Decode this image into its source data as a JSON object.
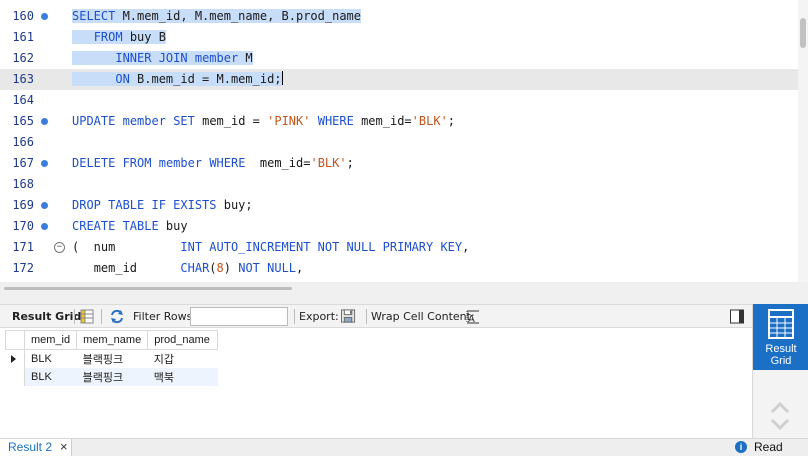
{
  "editor": {
    "lines": [
      {
        "n": "160",
        "marker": true,
        "fold": false,
        "current": false,
        "selected": true,
        "indent": "",
        "tokens": [
          [
            "kw",
            "SELECT"
          ],
          [
            "t",
            " M.mem_id, M.mem_name, B.prod_name"
          ]
        ]
      },
      {
        "n": "161",
        "marker": false,
        "fold": false,
        "current": false,
        "selected": true,
        "indent": "   ",
        "tokens": [
          [
            "kw",
            "FROM"
          ],
          [
            "t",
            " buy B"
          ]
        ]
      },
      {
        "n": "162",
        "marker": false,
        "fold": false,
        "current": false,
        "selected": true,
        "indent": "      ",
        "tokens": [
          [
            "kw",
            "INNER JOIN"
          ],
          [
            "t",
            " "
          ],
          [
            "kw",
            "member"
          ],
          [
            "t",
            " M"
          ]
        ]
      },
      {
        "n": "163",
        "marker": false,
        "fold": false,
        "current": true,
        "selected": true,
        "indent": "      ",
        "tokens": [
          [
            "kw",
            "ON"
          ],
          [
            "t",
            " B.mem_id = M.mem_id;"
          ]
        ]
      },
      {
        "n": "164",
        "marker": false,
        "fold": false,
        "current": false,
        "selected": false,
        "indent": "",
        "tokens": []
      },
      {
        "n": "165",
        "marker": true,
        "fold": false,
        "current": false,
        "selected": false,
        "indent": "",
        "tokens": [
          [
            "kw",
            "UPDATE"
          ],
          [
            "t",
            " "
          ],
          [
            "kw",
            "member"
          ],
          [
            "t",
            " "
          ],
          [
            "kw",
            "SET"
          ],
          [
            "t",
            " mem_id = "
          ],
          [
            "str",
            "'PINK'"
          ],
          [
            "t",
            " "
          ],
          [
            "kw",
            "WHERE"
          ],
          [
            "t",
            " mem_id="
          ],
          [
            "str",
            "'BLK'"
          ],
          [
            "t",
            ";"
          ]
        ]
      },
      {
        "n": "166",
        "marker": false,
        "fold": false,
        "current": false,
        "selected": false,
        "indent": "",
        "tokens": []
      },
      {
        "n": "167",
        "marker": true,
        "fold": false,
        "current": false,
        "selected": false,
        "indent": "",
        "tokens": [
          [
            "kw",
            "DELETE FROM"
          ],
          [
            "t",
            " "
          ],
          [
            "kw",
            "member"
          ],
          [
            "t",
            " "
          ],
          [
            "kw",
            "WHERE"
          ],
          [
            "t",
            "  mem_id="
          ],
          [
            "str",
            "'BLK'"
          ],
          [
            "t",
            ";"
          ]
        ]
      },
      {
        "n": "168",
        "marker": false,
        "fold": false,
        "current": false,
        "selected": false,
        "indent": "",
        "tokens": []
      },
      {
        "n": "169",
        "marker": true,
        "fold": false,
        "current": false,
        "selected": false,
        "indent": "",
        "tokens": [
          [
            "kw",
            "DROP TABLE IF EXISTS"
          ],
          [
            "t",
            " buy;"
          ]
        ]
      },
      {
        "n": "170",
        "marker": true,
        "fold": false,
        "current": false,
        "selected": false,
        "indent": "",
        "tokens": [
          [
            "kw",
            "CREATE TABLE"
          ],
          [
            "t",
            " buy"
          ]
        ]
      },
      {
        "n": "171",
        "marker": false,
        "fold": true,
        "current": false,
        "selected": false,
        "indent": "",
        "tokens": [
          [
            "t",
            "(  num         "
          ],
          [
            "kw",
            "INT AUTO_INCREMENT NOT NULL PRIMARY KEY"
          ],
          [
            "t",
            ","
          ]
        ]
      },
      {
        "n": "172",
        "marker": false,
        "fold": false,
        "current": false,
        "selected": false,
        "indent": "   ",
        "tokens": [
          [
            "t",
            "mem_id      "
          ],
          [
            "kw",
            "CHAR"
          ],
          [
            "t",
            "("
          ],
          [
            "num",
            "8"
          ],
          [
            "t",
            ") "
          ],
          [
            "kw",
            "NOT NULL"
          ],
          [
            "t",
            ","
          ]
        ]
      }
    ]
  },
  "toolbar": {
    "result_grid_label": "Result Grid",
    "filter_label": "Filter Rows:",
    "filter_value": "",
    "export_label": "Export:",
    "wrap_label": "Wrap Cell Content:"
  },
  "grid": {
    "columns": [
      "mem_id",
      "mem_name",
      "prod_name"
    ],
    "rows": [
      [
        "BLK",
        "블랙핑크",
        "지갑"
      ],
      [
        "BLK",
        "블랙핑크",
        "맥북"
      ]
    ]
  },
  "side_panel": {
    "result_grid_line1": "Result",
    "result_grid_line2": "Grid"
  },
  "status": {
    "tab_label": "Result 2",
    "readonly_label": "Read Only"
  },
  "colors": {
    "keyword": "#1e4fcf",
    "string": "#c4541c",
    "selection": "#c8def8",
    "accent": "#1b6fc4"
  }
}
